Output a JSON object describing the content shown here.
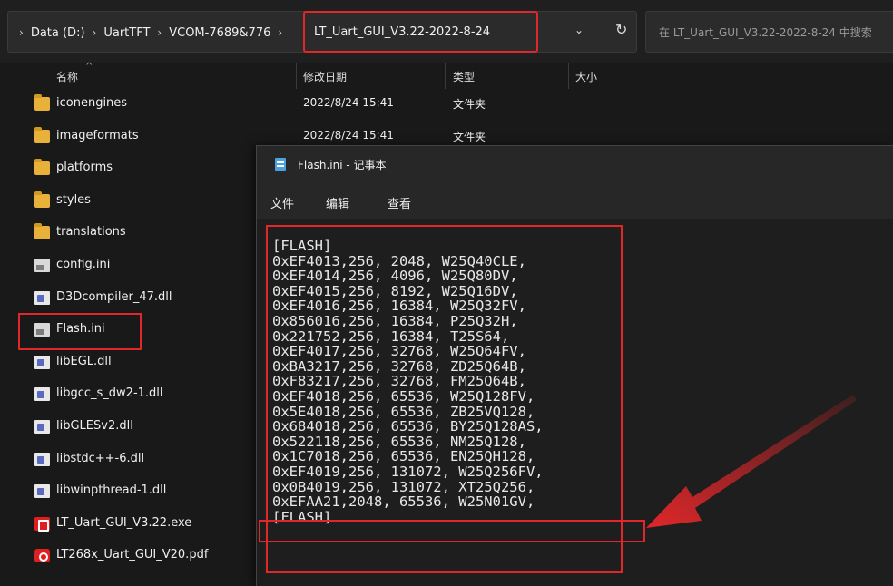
{
  "breadcrumb": {
    "lead_sep": "›",
    "items": [
      "Data (D:)",
      "UartTFT",
      "VCOM-7689&776"
    ],
    "sep": "›",
    "current": "LT_Uart_GUI_V3.22-2022-8-24"
  },
  "search": {
    "placeholder": "在 LT_Uart_GUI_V3.22-2022-8-24 中搜索"
  },
  "columns": {
    "name": "名称",
    "date": "修改日期",
    "type": "类型",
    "size": "大小"
  },
  "files": [
    {
      "name": "iconengines",
      "date": "2022/8/24 15:41",
      "type": "文件夹",
      "icon": "folder-icon"
    },
    {
      "name": "imageformats",
      "date": "2022/8/24 15:41",
      "type": "文件夹",
      "icon": "folder-icon"
    },
    {
      "name": "platforms",
      "date": "",
      "type": "",
      "icon": "folder-icon"
    },
    {
      "name": "styles",
      "date": "",
      "type": "",
      "icon": "folder-icon"
    },
    {
      "name": "translations",
      "date": "",
      "type": "",
      "icon": "folder-icon"
    },
    {
      "name": "config.ini",
      "date": "",
      "type": "",
      "icon": "ini-icon"
    },
    {
      "name": "D3Dcompiler_47.dll",
      "date": "",
      "type": "",
      "icon": "dll-icon"
    },
    {
      "name": "Flash.ini",
      "date": "",
      "type": "",
      "icon": "ini-icon"
    },
    {
      "name": "libEGL.dll",
      "date": "",
      "type": "",
      "icon": "dll-icon"
    },
    {
      "name": "libgcc_s_dw2-1.dll",
      "date": "",
      "type": "",
      "icon": "dll-icon"
    },
    {
      "name": "libGLESv2.dll",
      "date": "",
      "type": "",
      "icon": "dll-icon"
    },
    {
      "name": "libstdc++-6.dll",
      "date": "",
      "type": "",
      "icon": "dll-icon"
    },
    {
      "name": "libwinpthread-1.dll",
      "date": "",
      "type": "",
      "icon": "dll-icon"
    },
    {
      "name": "LT_Uart_GUI_V3.22.exe",
      "date": "",
      "type": "",
      "icon": "exe-icon"
    },
    {
      "name": "LT268x_Uart_GUI_V20.pdf",
      "date": "",
      "type": "",
      "icon": "pdf-icon"
    }
  ],
  "notepad": {
    "title": "Flash.ini - 记事本",
    "menu": {
      "file": "文件",
      "edit": "编辑",
      "view": "查看"
    },
    "lines": [
      "[FLASH]",
      "0xEF4013,256, 2048, W25Q40CLE,",
      "0xEF4014,256, 4096, W25Q80DV,",
      "0xEF4015,256, 8192, W25Q16DV,",
      "0xEF4016,256, 16384, W25Q32FV,",
      "0x856016,256, 16384, P25Q32H,",
      "0x221752,256, 16384, T25S64,",
      "0xEF4017,256, 32768, W25Q64FV,",
      "0xBA3217,256, 32768, ZD25Q64B,",
      "0xF83217,256, 32768, FM25Q64B,",
      "0xEF4018,256, 65536, W25Q128FV,",
      "0x5E4018,256, 65536, ZB25VQ128,",
      "0x684018,256, 65536, BY25Q128AS,",
      "0x522118,256, 65536, NM25Q128,",
      "0x1C7018,256, 65536, EN25QH128,",
      "0xEF4019,256, 131072, W25Q256FV,",
      "0x0B4019,256, 131072, XT25Q256,",
      "0xEFAA21,2048, 65536, W25N01GV,",
      "[FLASH]"
    ]
  },
  "colors": {
    "highlight": "#e0272a",
    "background": "#191919",
    "folder": "#e8b23a"
  }
}
